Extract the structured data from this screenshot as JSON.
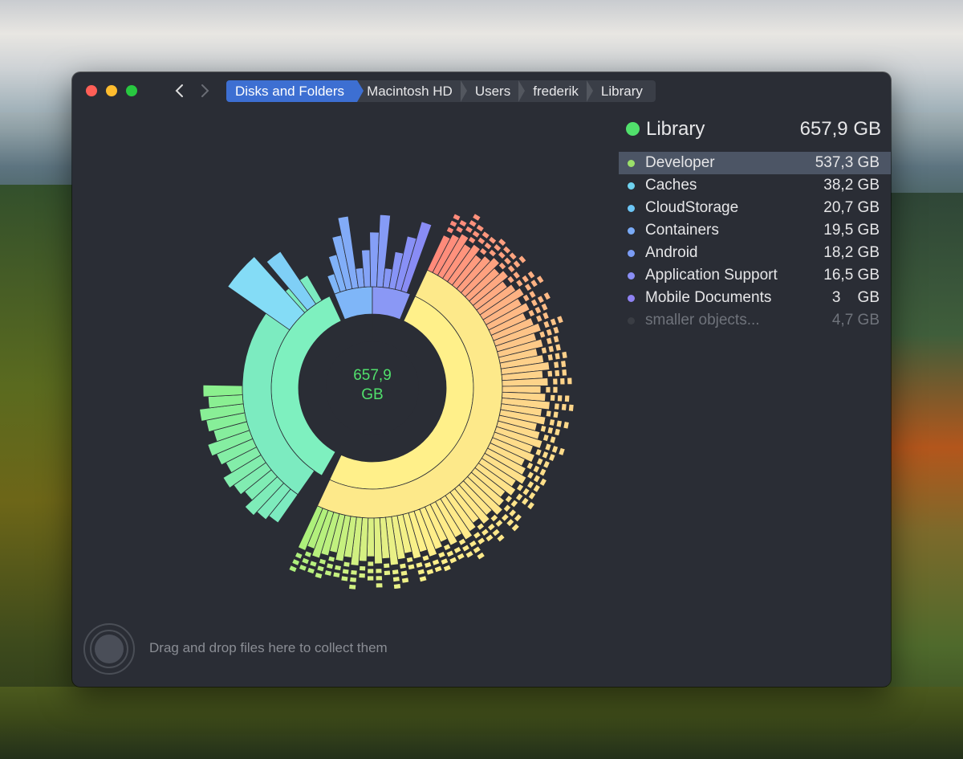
{
  "window": {
    "controls": {
      "close": "close",
      "minimize": "minimize",
      "maximize": "maximize"
    },
    "nav": {
      "back_icon": "chevron-left-icon",
      "forward_icon": "chevron-right-icon"
    },
    "breadcrumb": [
      "Disks and Folders",
      "Macintosh HD",
      "Users",
      "frederik",
      "Library"
    ]
  },
  "sunburst": {
    "center_value": "657,9",
    "center_unit": "GB",
    "colors": {
      "center_ring": "#9be06a",
      "hole": "#2a2d35"
    }
  },
  "sidebar": {
    "title": {
      "name": "Library",
      "size": "657,9 GB",
      "color": "#51e06c"
    },
    "items": [
      {
        "name": "Developer",
        "size": "537,3 GB",
        "color": "#9be06a",
        "selected": true
      },
      {
        "name": "Caches",
        "size": "38,2 GB",
        "color": "#6fd3f0"
      },
      {
        "name": "CloudStorage",
        "size": "20,7 GB",
        "color": "#6cc6f6"
      },
      {
        "name": "Containers",
        "size": "19,5 GB",
        "color": "#7aabf7"
      },
      {
        "name": "Android",
        "size": "18,2 GB",
        "color": "#7b9cf5"
      },
      {
        "name": "Application Support",
        "size": "16,5 GB",
        "color": "#8a8ef5"
      },
      {
        "name": "Mobile Documents",
        "size": "3    GB",
        "color": "#8f82f3"
      },
      {
        "name": "smaller objects...",
        "size": "4,7 GB",
        "color": "#3a3d44",
        "dim": true
      }
    ]
  },
  "footer": {
    "drop_text": "Drag and drop files here to collect them",
    "drop_icon": "collector-icon"
  }
}
